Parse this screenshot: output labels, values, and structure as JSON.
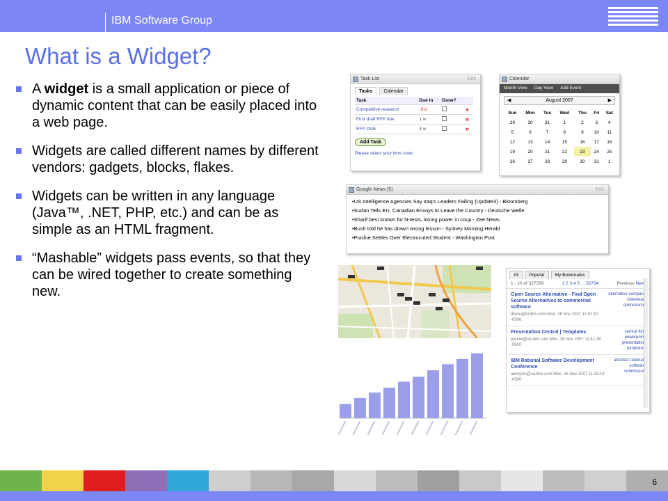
{
  "header": {
    "group_label": "IBM Software Group",
    "logo_text": "IBM"
  },
  "slide": {
    "title": "What is a Widget?",
    "bullets": [
      {
        "pre": "A ",
        "bold": "widget",
        "post": " is a small application or piece of dynamic content that can be easily placed into a web page."
      },
      {
        "pre": "Widgets are called different names by different vendors: gadgets, blocks, flakes.",
        "bold": "",
        "post": ""
      },
      {
        "pre": "Widgets can be written in any language (Java™, .NET, PHP, etc.) and can be as simple as an HTML fragment.",
        "bold": "",
        "post": ""
      },
      {
        "pre": "“Mashable” widgets pass events, so that they can be wired together to create something new.",
        "bold": "",
        "post": ""
      }
    ],
    "page_number": "6"
  },
  "task_widget": {
    "title": "Task List",
    "edit": "Edit",
    "tabs": [
      "Tasks",
      "Calendar"
    ],
    "columns": [
      "Task",
      "Due in",
      "Done?"
    ],
    "rows": [
      {
        "name": "Competitive research",
        "due": "-3 d"
      },
      {
        "name": "First draft RFP due",
        "due": "1 w"
      },
      {
        "name": "RFP DUE",
        "due": "4 w"
      }
    ],
    "add_label": "Add Task",
    "footer": "Please select your time zone"
  },
  "calendar_widget": {
    "title": "Calendar",
    "views": [
      "Month View",
      "Day View",
      "Add Event"
    ],
    "month": "August 2007",
    "days": [
      "Sun",
      "Mon",
      "Tue",
      "Wed",
      "Thu",
      "Fri",
      "Sat"
    ],
    "weeks": [
      [
        "29",
        "30",
        "31",
        "1",
        "2",
        "3",
        "4"
      ],
      [
        "5",
        "6",
        "7",
        "8",
        "9",
        "10",
        "11"
      ],
      [
        "12",
        "13",
        "14",
        "15",
        "16",
        "17",
        "18"
      ],
      [
        "19",
        "20",
        "21",
        "22",
        "23",
        "24",
        "25"
      ],
      [
        "26",
        "27",
        "28",
        "29",
        "30",
        "31",
        "1"
      ]
    ],
    "today": "23"
  },
  "news_widget": {
    "title": "Google News (5)",
    "edit": "Edit",
    "items": [
      "US Intelligence Agencies Say Iraq's Leaders Failing (Update3) - Bloomberg",
      "Sudan Tells EU, Canadian Envoys to Leave the Country - Deutsche Welle",
      "Sharif best known for N-tests, losing power in coup - Zee News",
      "Bush told he has drawn wrong lesson - Sydney Morning Herald",
      "Purdue Settles Over Electrocuted Student - Washington Post"
    ]
  },
  "bookmarks_widget": {
    "tabs": [
      "All",
      "Popular",
      "My Bookmarks"
    ],
    "pager_left": "1 - 10 of 327339",
    "pager_pages": "1 2 3 4 5 ... 32734",
    "pager_prev": "Previous",
    "pager_next": "Next",
    "items": [
      {
        "title": "Open Source Alternative - Find Open Source Alternatives to commercial software",
        "meta": "dneto@br.ibm.com Mon, 26 Nov 2007 11:51:10 -0500",
        "tags": "alternative compare download opensource"
      },
      {
        "title": "Presentation Central | Templates",
        "meta": "parkiw@uk.ibm.com Mon, 26 Nov 2007 11:41:38 -0500",
        "tags": "central ibm powerpoint presentation templates"
      },
      {
        "title": "IBM Rational Software Development Conference",
        "meta": "adreyzin@ca.ibm.com Mon, 26 Nov 2007 11:43:14 -0500",
        "tags": "abstract rational-software submission"
      }
    ]
  },
  "chart_data": {
    "type": "bar",
    "values": [
      3.5,
      5.0,
      6.3,
      7.5,
      9.0,
      10.2,
      11.8,
      13.3,
      14.6,
      16.0
    ],
    "ylim": [
      0,
      18
    ],
    "bar_color": "#9b9ee8"
  },
  "colors": {
    "header": "#7b86f7",
    "title": "#5a6fe8",
    "bullet": "#6674f2",
    "footer_blocks": [
      "#6fb34a",
      "#f3d24b",
      "#e01d1d",
      "#8f6fb6",
      "#2fa7d6",
      "#cfcfcf",
      "#b8b8b8",
      "#a8a8a8",
      "#d8d8d8",
      "#bcbcbc",
      "#a0a0a0",
      "#c9c9c9",
      "#e6e6e6",
      "#bdbdbd",
      "#d0d0d0",
      "#b0b0b0"
    ]
  }
}
